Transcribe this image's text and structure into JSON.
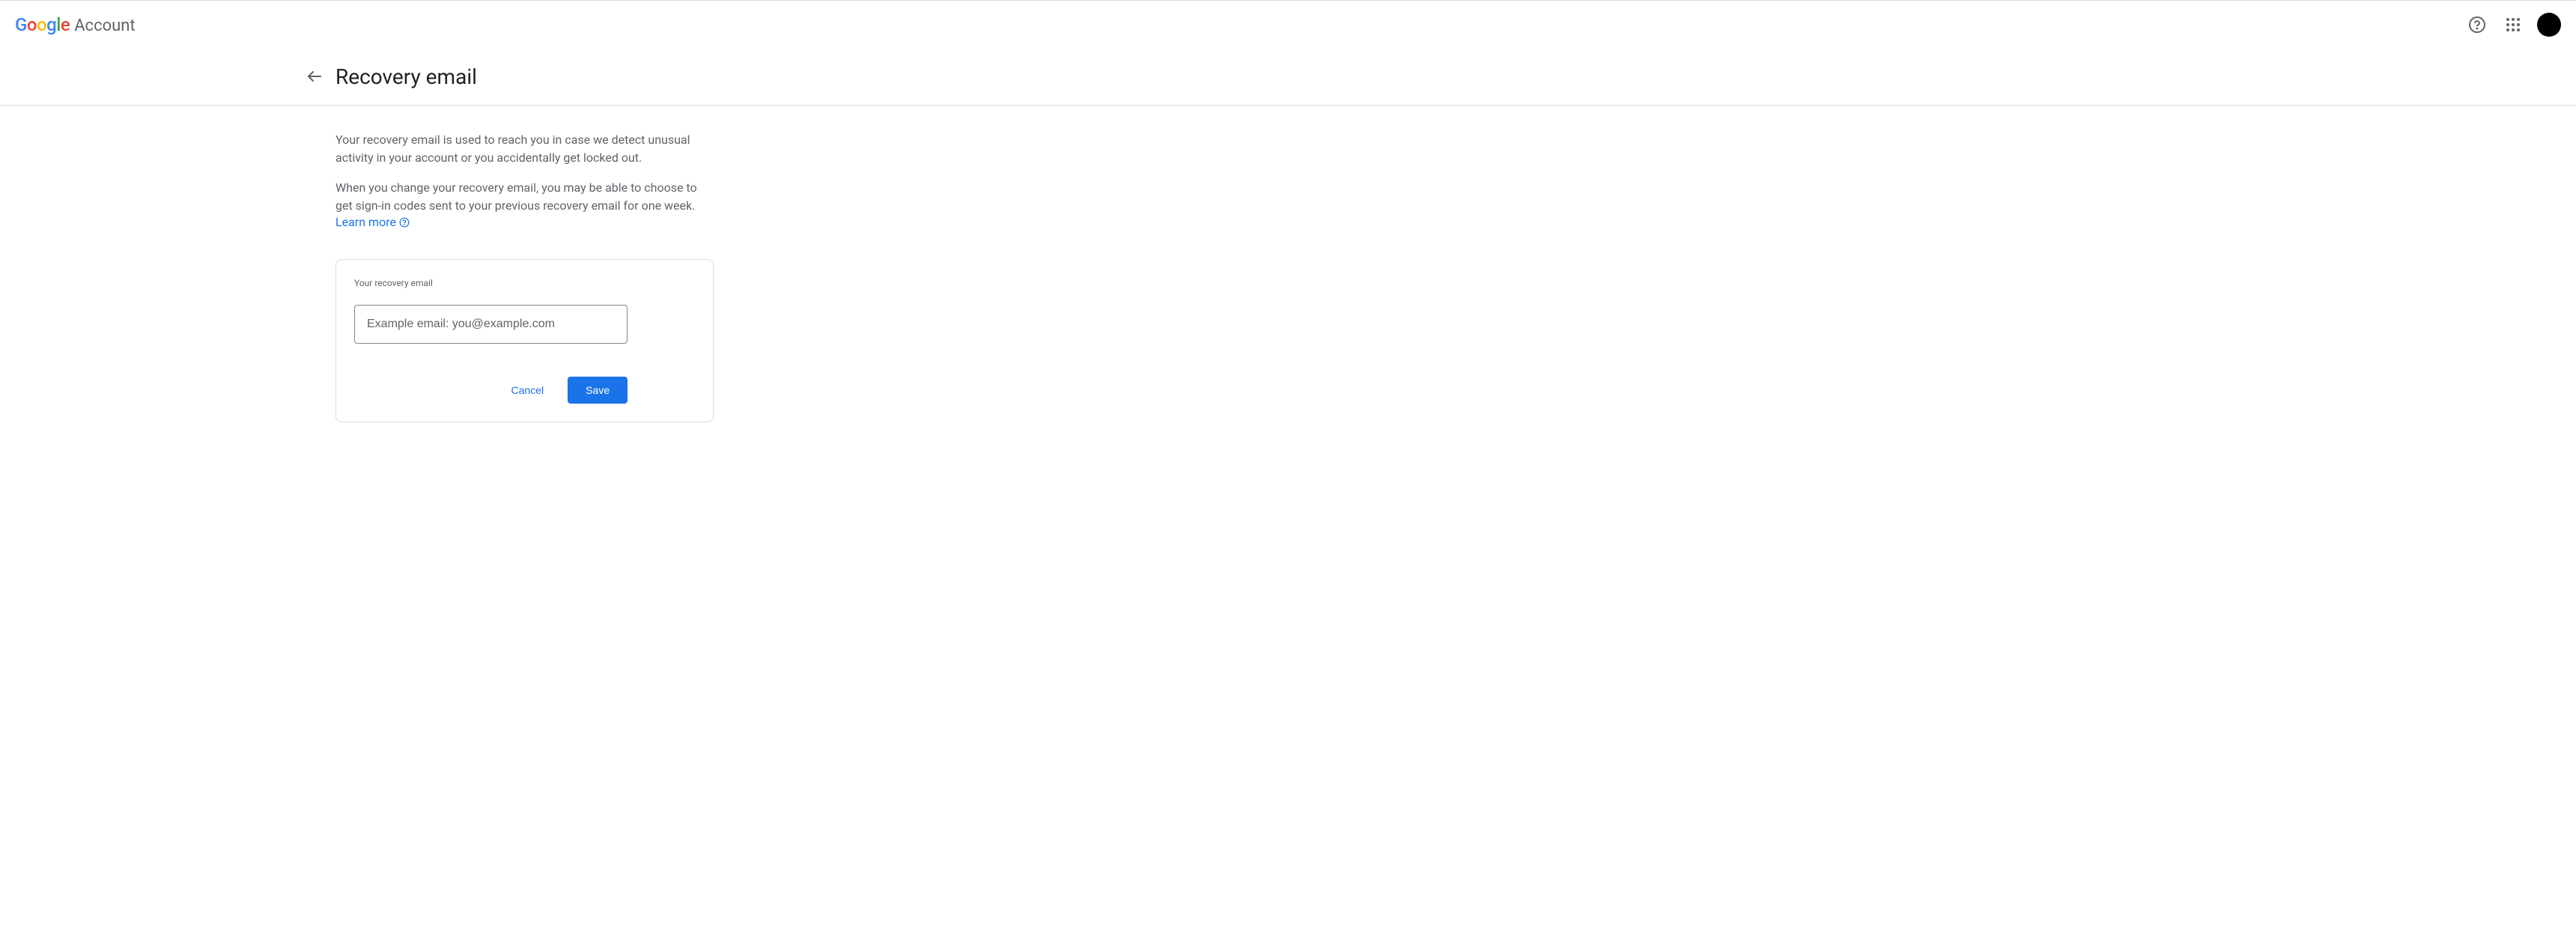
{
  "header": {
    "logo_text": "Google",
    "product_label": "Account"
  },
  "page": {
    "title": "Recovery email",
    "description1": "Your recovery email is used to reach you in case we detect unusual activity in your account or you accidentally get locked out.",
    "description2": "When you change your recovery email, you may be able to choose to get sign-in codes sent to your previous recovery email for one week.",
    "learn_more_label": "Learn more"
  },
  "form": {
    "field_label": "Your recovery email",
    "placeholder": "Example email: you@example.com",
    "value": "",
    "cancel_label": "Cancel",
    "save_label": "Save"
  }
}
